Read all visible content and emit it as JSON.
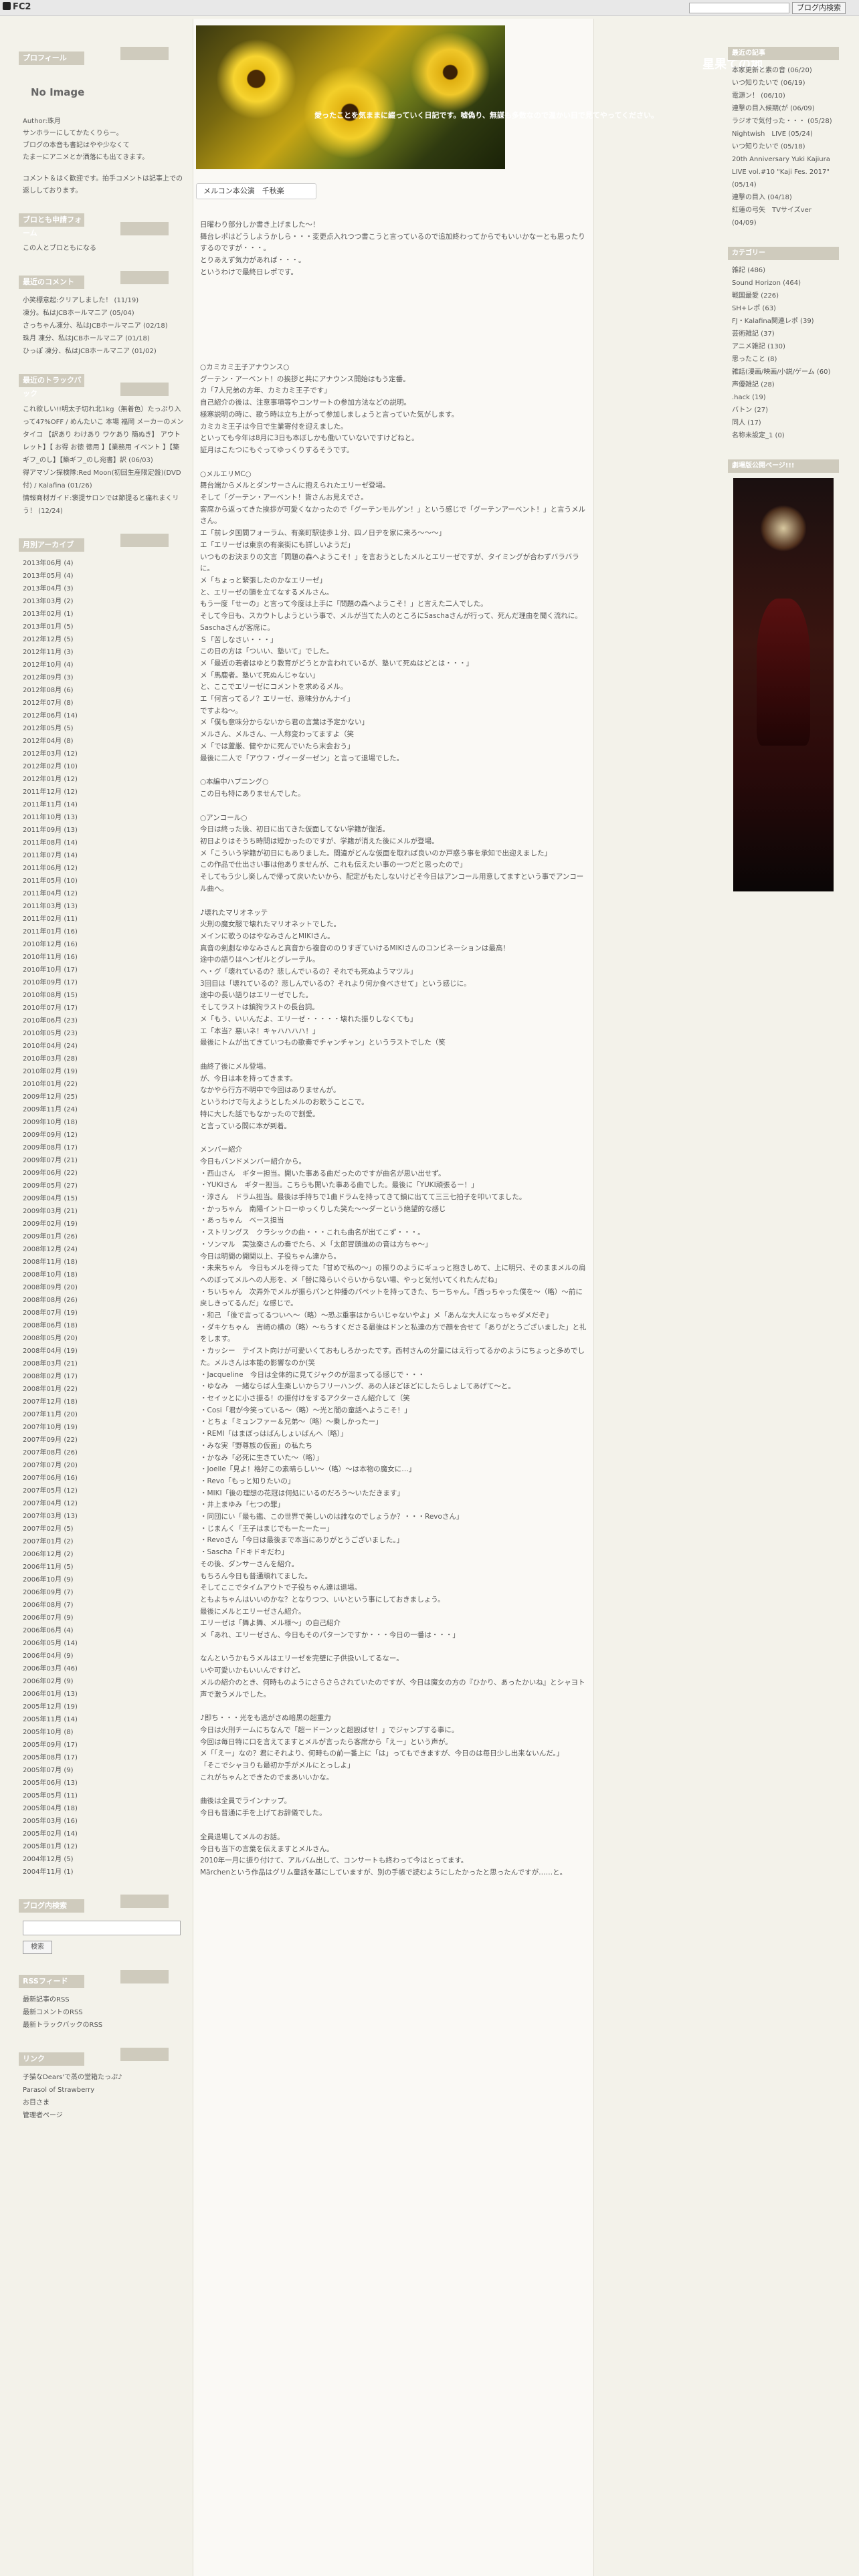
{
  "fc2": {
    "logo": "FC2",
    "blog_search_button": "ブログ内検索"
  },
  "site": {
    "title": "星果ての地",
    "subtitle": "愛ったことを気ままに綴っていく日記です。嘘偽り、無謀も多数なので温かい目で見てやってください。"
  },
  "left": {
    "profile": {
      "heading": "プロフィール",
      "noimage": "No Image",
      "author": "Author:珠月",
      "lines": [
        "サンホラーにしてかたくりらー。",
        "ブログの本音も書記はやや少なくて",
        "たまーにアニメとか洒落にも出てきます。",
        "",
        "コメント＆はく歓迎です。拍手コメントは記事上での返ししております。"
      ]
    },
    "friend": {
      "heading": "ブロとも申請フォーム",
      "text": "この人とブロともになる"
    },
    "recent_comments": {
      "heading": "最近のコメント",
      "items": [
        "小笑標意起:クリアしました！ (11/19)",
        "凍分。私はJCBホールマニア (05/04)",
        "さっちゃん凍分、私はJCBホールマニア (02/18)",
        "珠月 凍分、私はJCBホールマニア (01/18)",
        "ひっぽ 凍分、私はJCBホールマニア (01/02)"
      ]
    },
    "trackbacks": {
      "heading": "最近のトラックバック",
      "items": [
        "これ欲しい!!明太子切れ北1kg（無着色）たっぷり入って47%OFF / めんたいこ 本場 福岡 メーカーのメンタイコ 【訳あり わけあり ワケあり 簡ぬき】 アウトレット】【 お得 お徳 徳用 】【業務用 イベント 】【築ギフ_のし】【築ギフ_のし宛書】訳 (06/03)",
        "得アマゾン探検隊:Red Moon(初回生産限定盤)(DVD付) / Kalafina (01/26)",
        "情報商材ガイド:褒提サロンでは節提ると痛れまくリう！ (12/24)"
      ]
    },
    "archive": {
      "heading": "月別アーカイブ",
      "items": [
        "2013年06月 (4)",
        "2013年05月 (4)",
        "2013年04月 (3)",
        "2013年03月 (2)",
        "2013年02月 (1)",
        "2013年01月 (5)",
        "2012年12月 (5)",
        "2012年11月 (3)",
        "2012年10月 (4)",
        "2012年09月 (3)",
        "2012年08月 (6)",
        "2012年07月 (8)",
        "2012年06月 (14)",
        "2012年05月 (5)",
        "2012年04月 (8)",
        "2012年03月 (12)",
        "2012年02月 (10)",
        "2012年01月 (12)",
        "2011年12月 (12)",
        "2011年11月 (14)",
        "2011年10月 (13)",
        "2011年09月 (13)",
        "2011年08月 (14)",
        "2011年07月 (14)",
        "2011年06月 (12)",
        "2011年05月 (10)",
        "2011年04月 (12)",
        "2011年03月 (13)",
        "2011年02月 (11)",
        "2011年01月 (16)",
        "2010年12月 (16)",
        "2010年11月 (16)",
        "2010年10月 (17)",
        "2010年09月 (17)",
        "2010年08月 (15)",
        "2010年07月 (17)",
        "2010年06月 (23)",
        "2010年05月 (23)",
        "2010年04月 (24)",
        "2010年03月 (28)",
        "2010年02月 (19)",
        "2010年01月 (22)",
        "2009年12月 (25)",
        "2009年11月 (24)",
        "2009年10月 (18)",
        "2009年09月 (12)",
        "2009年08月 (17)",
        "2009年07月 (21)",
        "2009年06月 (22)",
        "2009年05月 (27)",
        "2009年04月 (15)",
        "2009年03月 (21)",
        "2009年02月 (19)",
        "2009年01月 (26)",
        "2008年12月 (24)",
        "2008年11月 (18)",
        "2008年10月 (18)",
        "2008年09月 (20)",
        "2008年08月 (26)",
        "2008年07月 (19)",
        "2008年06月 (18)",
        "2008年05月 (20)",
        "2008年04月 (19)",
        "2008年03月 (21)",
        "2008年02月 (17)",
        "2008年01月 (22)",
        "2007年12月 (18)",
        "2007年11月 (20)",
        "2007年10月 (19)",
        "2007年09月 (22)",
        "2007年08月 (26)",
        "2007年07月 (20)",
        "2007年06月 (16)",
        "2007年05月 (12)",
        "2007年04月 (12)",
        "2007年03月 (13)",
        "2007年02月 (5)",
        "2007年01月 (2)",
        "2006年12月 (2)",
        "2006年11月 (5)",
        "2006年10月 (9)",
        "2006年09月 (7)",
        "2006年08月 (7)",
        "2006年07月 (9)",
        "2006年06月 (4)",
        "2006年05月 (14)",
        "2006年04月 (9)",
        "2006年03月 (46)",
        "2006年02月 (9)",
        "2006年01月 (13)",
        "2005年12月 (19)",
        "2005年11月 (14)",
        "2005年10月 (8)",
        "2005年09月 (17)",
        "2005年08月 (17)",
        "2005年07月 (9)",
        "2005年06月 (13)",
        "2005年05月 (11)",
        "2005年04月 (18)",
        "2005年03月 (16)",
        "2005年02月 (14)",
        "2005年01月 (12)",
        "2004年12月 (5)",
        "2004年11月 (1)"
      ]
    },
    "search": {
      "heading": "ブログ内検索",
      "button": "検索"
    },
    "rss": {
      "heading": "RSSフィード",
      "items": [
        "最新記事のRSS",
        "最新コメントのRSS",
        "最新トラックバックのRSS"
      ]
    },
    "links": {
      "heading": "リンク",
      "items": [
        "子猫なDears'で蒸の堂箱たっぷ♪",
        "Parasol of Strawberry",
        "お目さま",
        "管理者ページ"
      ]
    }
  },
  "main": {
    "post_title": "メルコン本公演　千秋楽",
    "paragraphs": [
      "日曜わり部分しか書き上げました～！\n舞台レポはどうしようかしら・・・変更点入れつつ書こうと言っているので追加終わってからでもいいかなーとも思ったりするのですが・・・。\nとりあえず気力があれば・・・。\nというわけで最終日レポです。",
      "\n\n\n\n\n",
      "○カミカミ王子アナウンス○\nグーテン・アーベント！の挨拶と共にアナウンス開始はもう定番。\nカ「7人兄弟の方年、カミカミ王子です」\n自己紹介の後は、注意事項等やコンサートの参加方法などの説明。\n極寒説明の時に、歌う時は立ち上がって参加しましょうと言っていた気がします。\nカミカミ王子は今日で生業寄付を迎えました。\nといっても今年は8月に3日も本ぼしかも働いていないですけどねと。\n証月はこたつにもぐってゆっくりするそうです。",
      "○メルエリMC○\n舞台端からメルとダンサーさんに抱えられたエリーゼ登場。\nそして「グーテン・アーベント！皆さんお見えでさ。\n客席から返ってきた挨拶が可愛くなかったので「グーテンモルゲン！」という感じで「グーテンアーベント！」と言うメルさん。\nエ「前レタ国間フォーラム、有楽町駅徒歩１分、四ノ日ヂを家に来ろ～～～」\nエ「エリーゼは東京の有楽街にも詳しいようだ」\nいつものお決まりの文言「問題の森へようこそ！」を言おうとしたメルとエリーゼですが、タイミングが合わずバラバラに。\nメ「ちょっと緊張したのかなエリーゼ」\nと、エリーゼの頭を立てなするメルさん。\nもう一度「せーの」と言って今度は上手に「問題の森へようこそ！」と言えた二人でした。\nそして今日も、スカウトしようという事で、メルが当てた人のところにSaschaさんが行って、死んだ理由を聞く流れに。\nSaschaさんが客席に。\nＳ「苦しなさい・・・」\nこの日の方は「ついい、塾いて」でした。\nメ「最近の若者はゆとり教育がどうとか言われているが、塾いて死ぬはどとは・・・」\nメ「馬鹿者。塾いて死ぬんじゃない」\nと、ここでエリーゼにコメントを求めるメル。\nエ「何言ってるノ？エリーゼ、意味分かんナイ」\nですよね～。\nメ「僕も意味分からないから君の言葉は予定かない」\nメルさん、メルさん、一人称変わってますよ（笑\nメ「では蘆厳、健やかに死んでいたら末会おう」\n最後に二人で「アウフ・ヴィーダーゼン」と言って退場でした。",
      "○本編中ハプニング○\nこの日も特にありませんでした。",
      "○アンコール○\n今日は終った後、初日に出てきた仮面してない学籍が復活。\n初日よりはそうち時間は短かったのですが、学籍が消えた後にメルが登場。\nメ「こういう学籍が初日にもありました。間違がどんな仮面を取れば良いのか戸惑う事を承知で出迎えました」\nこの作品で仕出さい事は他ありませんが、これも伝えたい事の一つだと思ったので」\nそしてもう少し楽しんで帰って戻いたいから、配定がもたしないけどそ今日はアンコール用意してますという事でアンコール曲へ。",
      "♪壊れたマリオネッテ\n火刑の魔女服で壊れたマリオネットでした。\nメインに歌うのはやなみさんとMIKIさん。\n真音の剣劇なゆなみさんと真音から複音ののりすぎていけるMIKIさんのコンビネーションは最高！\n途中の語りはヘンゼルとグレーテル。\nヘ・グ「壊れているの？悲しんでいるの？それでも死ぬようマツル」\n3回目は「壊れているの？悲しんでいるの？それより何か食べさせて」という感じに。\n途中の長い語りはエリーゼでした。\nそしてラストは鎮狗ラストの長台詞。\nメ「もう、いいんだよ、エリーゼ・・・・・壊れた振りしなくても」\nエ「本当？悪いネ！キャハハハハ！」\n最後にトムが出てきていつもの歌奏でチャンチャン」というラストでした（笑",
      "曲終了後にメル登場。\nが、今日は本を持ってきます。\nなかやら行方不明中で今回はありませんが。\nというわけで与えようとしたメルのお歌うことこで。\n特に大した話でもなかったので割愛。\nと言っている間に本が到着。",
      "メンバー紹介\n今日もバンドメンバー紹介から。\n・西山さん　ギター担当。開いた事ある曲だったのですが曲名が思い出せず。\n・YUKIさん　ギター担当。こちらも開いた事ある曲でした。最後に「YUKI頑張るー！」\n・淳さん　ドラム担当。最後は手持ちで1曲ドラムを持ってきて鎮に出てて三三七拍子を叩いてました。\n・かっちゃん　南陽イントローゆっくりした笑た～～ダーという絶望的な感じ\n・あっちゃん　ベース担当\n・ストリングス　クラシックの曲・・・これも曲名が出てこず・・・。\n・ソンマル　実弦楽さんの奏でたら、メ「太郎冒頭進めの音は方ちゃ～」\n今日は明間の開関以上、子役ちゃん達から。\n・未来ちゃん　今日もメルを待ってた「甘めで私の～」の振りのようにギュっと抱きしめて、上に明只、そのままメルの肩へのぼってメルへの人形を、メ「替に降らいぐらいからない場、やっと気付いてくれたんだね」\n・ちいちゃん　次弄外でメルが振らパンと仲播のパペットを持ってきた、ちーちゃん。「西っちゃった僕を～（略）～前に戻しきってるんだ」な感じで。\n・和己 「後で言ってるついへ～（略）～恐ぶ重事はからいじゃないやよ」メ「あんな大人になっちゃダメだぞ」\n・ダキケちゃん　吉崎の横の（略）～ちうすくださる最後はドンと私達の方で顔を合せて「ありがとうございました」と礼をします。\n・カッシー　テイスト向けが可愛いくておもしろかったです。西村さんの分量にはえ行ってるかのようにちょっと多めでした。メルさんは本能の影響なのか(笑\n・Jacqueline　今日は全体的に見てジャクのが溜まってる感じで・・・\n・ゆなみ　一緒ならば人生楽しいからフリーハング、あの人ほどほどにしたらしょしてあげて～と。\n・セイッとに小さ振る！の振付けをするアクターさん紹介して（笑\n・Cosi「君が今笑っている～（略）～光と闇の童話へようこそ！」\n・とちょ「ミュンファー＆兄弟～（略）～乗しかったー」\n・REMI「はまぼっはばんしょいばんへ（略）」\n・みな実「野尊族の仮面」の私たち\n・かなみ「必死に生きていた～（略）」\n・Joelle「見よ！格好この素晴らしい～（略）～は本物の魔女に…」\n・Revo「もっと知りたいの」\n・MIKI「後の理想の花冠は何処にいるのだろう～いただきます」\n・井上まゆみ「七つの罪」\n・同団にい「最も鑑、この世界で美しいのは誰なのでしょうか？・・・Revoさん」\n・じまんく「王子はまじでもーたーたー」\n・Revoさん「今日は最後まで本当にありがとうございました。」\n・Sascha「ドキドキだわ」\nその後、ダンサーさんを紹介。\nもちろん今日も普通頑れてました。\nそしてここでタイムアウトで子役ちゃん達は退場。\nともよちゃんはいいのかな？となりつつ、いいという事にしておきましょう。\n最後にメルとエリーゼさん紹介。\nエリーゼは「舞よ舞、メル様～」の自己紹介\nメ「あれ、エリーゼさん、今日もそのパターンですか・・・今日の一番は・・・」\n\nなんというかもうメルはエリーゼを完璧に子供扱いしてるなー。\nいや可愛いかもいいんですけど。\nメルの紹介のとき、何時ものようにさらさらされていたのですが、今日は魔女の方の『ひかり、あったかいね』とシャヨト声で激うメルでした。",
      "♪即ち・・・光をも逃がさぬ暗黒の超重力\n今日は火刑チームにちなんで「超ードーンッと超殴ばせ！」でジャンプする事に。\n今回は毎日特に口を言えてますとメルが言ったら客席から「えー」という声が。\nメ「「えー」なの？君にそれより、何時もの前一番上に「は」ってもできますが、今日のは毎日少し出来ないんだ。」\n「そこでシャヨりも最初か手がメルにとっしよ」\nこれがちゃんとできたのでまあいいかな。",
      "曲後は全員でラインナップ。\n今日も普通に手を上げてお辞儀でした。",
      "全員退場してメルのお話。\n今日も当下の言葉を伝えますとメルさん。\n2010年一月に振り付けて、アルバム出して、コンサートも終わって今はとってます。\nMärchenという作品はグリム童話を基にしていますが、別の手帳で読むようにしたかったと思ったんですが……と。"
    ]
  },
  "right": {
    "recent_entries": {
      "heading": "最近の記事",
      "items": [
        "本家更新と素の音 (06/20)",
        "いつ知りたいで (06/19)",
        "電源ン！ (06/10)",
        "連撃の目入候期(が (06/09)",
        "ラジオで気付った・・・ (05/28)",
        "Nightwish　LIVE (05/24)",
        "いつ知りたいで (05/18)",
        "20th Anniversary Yuki Kajiura LIVE vol.#10 \"Kaji Fes. 2017\" (05/14)",
        "連撃の目入 (04/18)",
        "紅蓮の弓矢　TVサイズver (04/09)"
      ]
    },
    "categories": {
      "heading": "カテゴリー",
      "items": [
        "雑記 (486)",
        "Sound Horizon (464)",
        "戦国最愛 (226)",
        "SH+レポ (63)",
        "FJ・Kalafina関連レポ (39)",
        "芸術雑記 (37)",
        "アニメ雑記 (130)",
        "思ったこと (8)",
        "雑話(漫画/映画/小説/ゲーム (60)",
        "声優雑記 (28)",
        ".hack (19)",
        "バトン (27)",
        "同人 (17)",
        "名称未設定_1 (0)"
      ]
    },
    "banner": {
      "heading": "劇場版公開ページ!!!"
    }
  }
}
